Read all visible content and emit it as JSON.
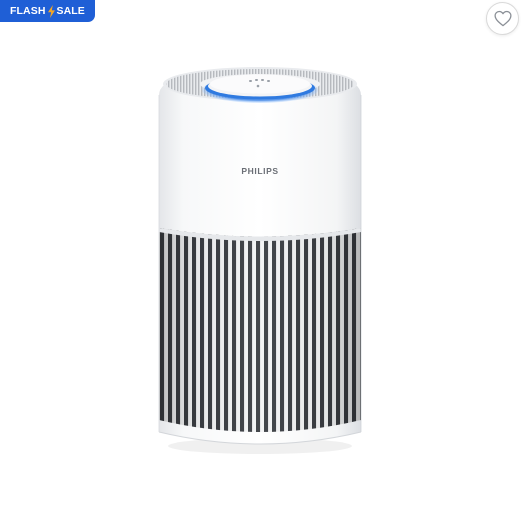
{
  "badge": {
    "text_left": "FLASH",
    "text_right": "SALE",
    "bolt_icon": "lightning-bolt-icon",
    "bg_color": "#1f5fd6",
    "bolt_color": "#f5a623"
  },
  "wishlist": {
    "icon": "heart-outline-icon"
  },
  "product": {
    "brand_label": "PHILIPS",
    "ring_color": "#3f86e8"
  }
}
